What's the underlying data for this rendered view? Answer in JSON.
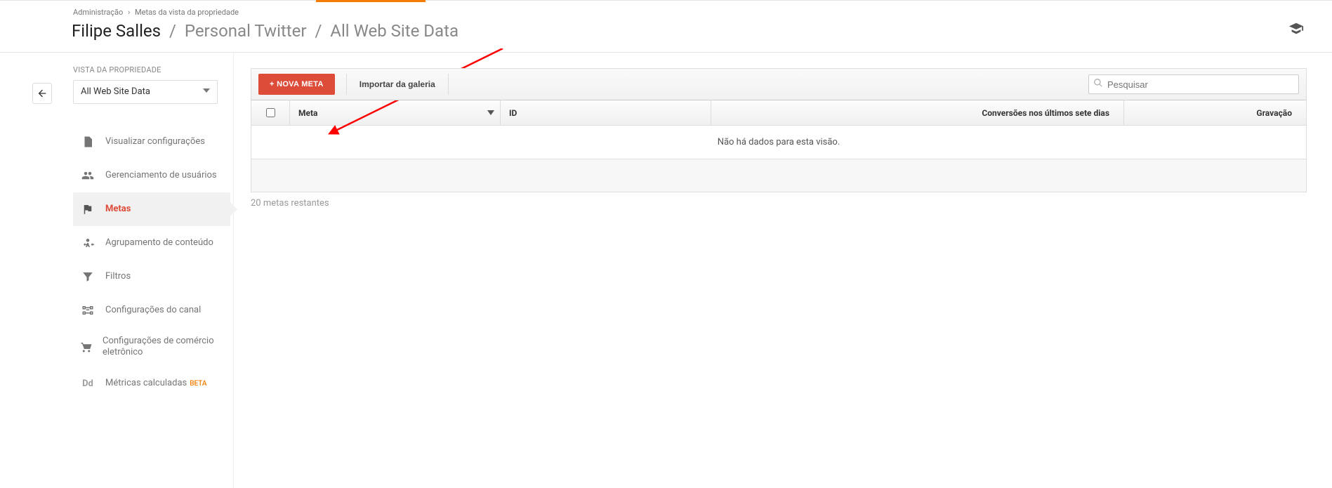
{
  "breadcrumbs": {
    "root": "Administração",
    "current": "Metas da vista da propriedade"
  },
  "title": {
    "account": "Filipe Salles",
    "property": "Personal Twitter",
    "view": "All Web Site Data"
  },
  "sidebar": {
    "section_label": "VISTA DA PROPRIEDADE",
    "view_select": "All Web Site Data",
    "items": [
      {
        "label": "Visualizar configurações"
      },
      {
        "label": "Gerenciamento de usuários"
      },
      {
        "label": "Metas"
      },
      {
        "label": "Agrupamento de conteúdo"
      },
      {
        "label": "Filtros"
      },
      {
        "label": "Configurações do canal"
      },
      {
        "label": "Configurações de comércio eletrônico"
      },
      {
        "label": "Métricas calculadas",
        "beta": "BETA"
      }
    ]
  },
  "actions": {
    "new_goal": "+ NOVA META",
    "import_gallery": "Importar da galeria",
    "search_placeholder": "Pesquisar"
  },
  "table": {
    "headers": {
      "meta": "Meta",
      "id": "ID",
      "conversions": "Conversões nos últimos sete dias",
      "recording": "Gravação"
    },
    "empty_message": "Não há dados para esta visão.",
    "remaining": "20 metas restantes"
  }
}
